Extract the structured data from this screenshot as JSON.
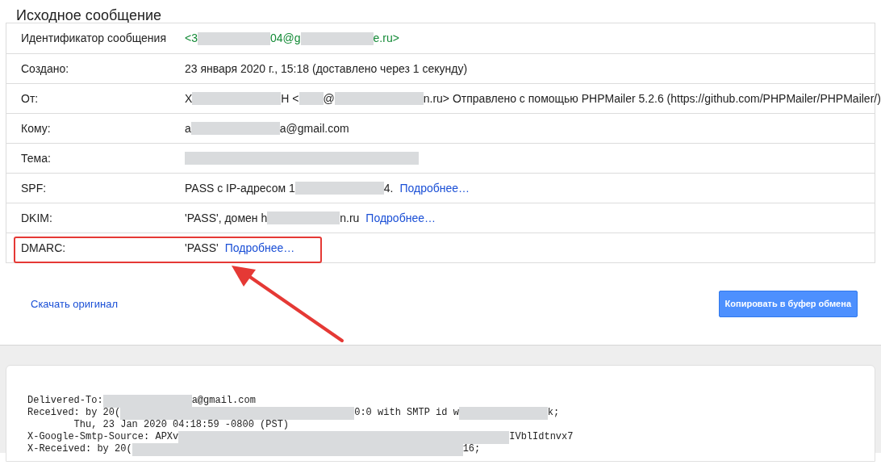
{
  "title": "Исходное сообщение",
  "rows": [
    {
      "label": "Идентификатор сообщения",
      "highlighted": false,
      "parts": [
        {
          "kind": "id",
          "text": "<3"
        },
        {
          "kind": "blur"
        },
        {
          "kind": "id",
          "text": "04@g"
        },
        {
          "kind": "blur"
        },
        {
          "kind": "id",
          "text": "e.ru>"
        }
      ]
    },
    {
      "label": "Создано:",
      "highlighted": false,
      "parts": [
        {
          "kind": "text",
          "text": "23 января 2020 г., 15:18 (доставлено через 1 секунду)"
        }
      ]
    },
    {
      "label": "От:",
      "highlighted": false,
      "parts": [
        {
          "kind": "text",
          "text": "Х"
        },
        {
          "kind": "blurlong"
        },
        {
          "kind": "text",
          "text": "Н <"
        },
        {
          "kind": "blurshort"
        },
        {
          "kind": "text",
          "text": "@"
        },
        {
          "kind": "blurlong"
        },
        {
          "kind": "text",
          "text": "n.ru> Отправлено с помощью PHPMailer 5.2.6 (https://github.com/PHPMailer/PHPMailer/)"
        }
      ]
    },
    {
      "label": "Кому:",
      "highlighted": false,
      "parts": [
        {
          "kind": "text",
          "text": "a"
        },
        {
          "kind": "blurlong"
        },
        {
          "kind": "text",
          "text": "a@gmail.com"
        }
      ]
    },
    {
      "label": "Тема:",
      "highlighted": false,
      "parts": [
        {
          "kind": "blurwide"
        }
      ]
    },
    {
      "label": "SPF:",
      "highlighted": false,
      "parts": [
        {
          "kind": "text",
          "text": "PASS с IP-адресом 1"
        },
        {
          "kind": "blurlong"
        },
        {
          "kind": "text",
          "text": "4."
        },
        {
          "kind": "link",
          "text": "Подробнее…"
        }
      ]
    },
    {
      "label": "DKIM:",
      "highlighted": false,
      "parts": [
        {
          "kind": "text",
          "text": "'PASS', домен h"
        },
        {
          "kind": "blur"
        },
        {
          "kind": "text",
          "text": "n.ru"
        },
        {
          "kind": "link",
          "text": "Подробнее…"
        }
      ]
    },
    {
      "label": "DMARC:",
      "highlighted": true,
      "parts": [
        {
          "kind": "text",
          "text": "'PASS'"
        },
        {
          "kind": "link",
          "text": "Подробнее…"
        }
      ]
    }
  ],
  "download_link": "Скачать оригинал",
  "copy_button": "Копировать в буфер обмена",
  "raw_lines": [
    [
      {
        "kind": "text",
        "text": "Delivered-To:"
      },
      {
        "kind": "blurlong"
      },
      {
        "kind": "text",
        "text": "a@gmail.com"
      }
    ],
    [
      {
        "kind": "text",
        "text": "Received: by 20("
      },
      {
        "kind": "blurwide"
      },
      {
        "kind": "text",
        "text": "0:0 with SMTP id w"
      },
      {
        "kind": "blurlong"
      },
      {
        "kind": "text",
        "text": "k;"
      }
    ],
    [
      {
        "kind": "text",
        "text": "        Thu, 23 Jan 2020 04:18:59 -0800 (PST)"
      }
    ],
    [
      {
        "kind": "text",
        "text": "X-Google-Smtp-Source: APXv"
      },
      {
        "kind": "blurhuge"
      },
      {
        "kind": "text",
        "text": "IVblIdtnvx7"
      }
    ],
    [
      {
        "kind": "text",
        "text": "X-Received: by 20("
      },
      {
        "kind": "blurhuge"
      },
      {
        "kind": "text",
        "text": "16;"
      }
    ]
  ]
}
